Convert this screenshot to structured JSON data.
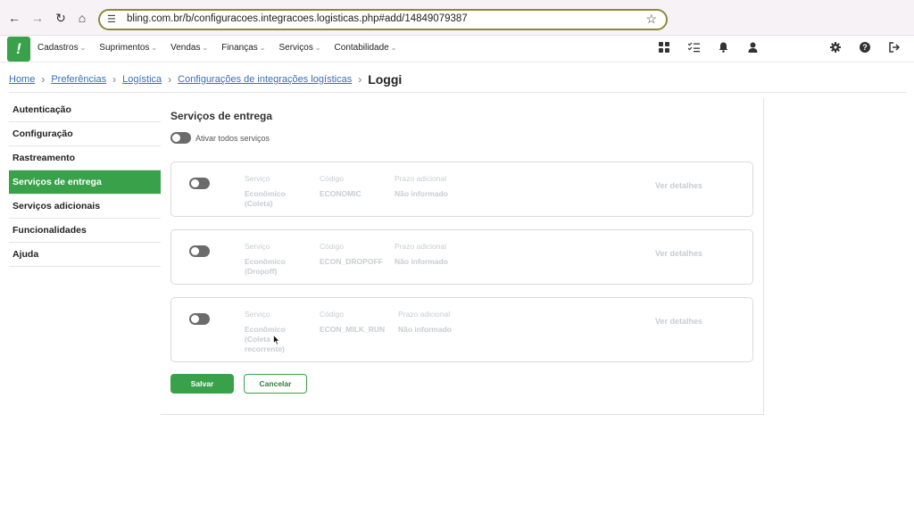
{
  "browser": {
    "url": "bling.com.br/b/configuracoes.integracoes.logisticas.php#add/14849079387",
    "back_icon": "arrow-left",
    "forward_icon": "arrow-right",
    "reload_icon": "reload",
    "home_icon": "home",
    "star_icon": "star"
  },
  "header": {
    "menu": [
      {
        "label": "Cadastros"
      },
      {
        "label": "Suprimentos"
      },
      {
        "label": "Vendas"
      },
      {
        "label": "Finanças"
      },
      {
        "label": "Serviços"
      },
      {
        "label": "Contabilidade"
      }
    ],
    "logo_text": "!"
  },
  "breadcrumb": {
    "items": [
      "Home",
      "Preferências",
      "Logística",
      "Configurações de integrações logísticas"
    ],
    "current": "Loggi"
  },
  "sidebar": {
    "items": [
      {
        "label": "Autenticação"
      },
      {
        "label": "Configuração"
      },
      {
        "label": "Rastreamento"
      },
      {
        "label": "Serviços de entrega",
        "active": true
      },
      {
        "label": "Serviços adicionais"
      },
      {
        "label": "Funcionalidades"
      },
      {
        "label": "Ajuda"
      }
    ]
  },
  "main": {
    "title": "Serviços de entrega",
    "toggle_all_label": "Ativar todos serviços",
    "services": [
      {
        "service_label": "Serviço",
        "service_value": "Econômico (Coleta)",
        "code_label": "Código",
        "code_value": "ECONOMIC",
        "deadline_label": "Prazo adicional",
        "deadline_value": "Não informado",
        "details_label": "Ver detalhes",
        "enabled": false
      },
      {
        "service_label": "Serviço",
        "service_value": "Econômico (Dropoff)",
        "code_label": "Código",
        "code_value": "ECON_DROPOFF",
        "deadline_label": "Prazo adicional",
        "deadline_value": "Não informado",
        "details_label": "Ver detalhes",
        "enabled": false
      },
      {
        "service_label": "Serviço",
        "service_value": "Econômico (Coleta recorrente)",
        "code_label": "Código",
        "code_value": "ECON_MILK_RUN",
        "deadline_label": "Prazo adicional",
        "deadline_value": "Não informado",
        "details_label": "Ver detalhes",
        "enabled": false
      }
    ],
    "save_label": "Salvar",
    "cancel_label": "Cancelar"
  },
  "colors": {
    "accent": "#3aa14b",
    "link": "#3b6fb6",
    "muted_text": "#c8ccd1"
  }
}
